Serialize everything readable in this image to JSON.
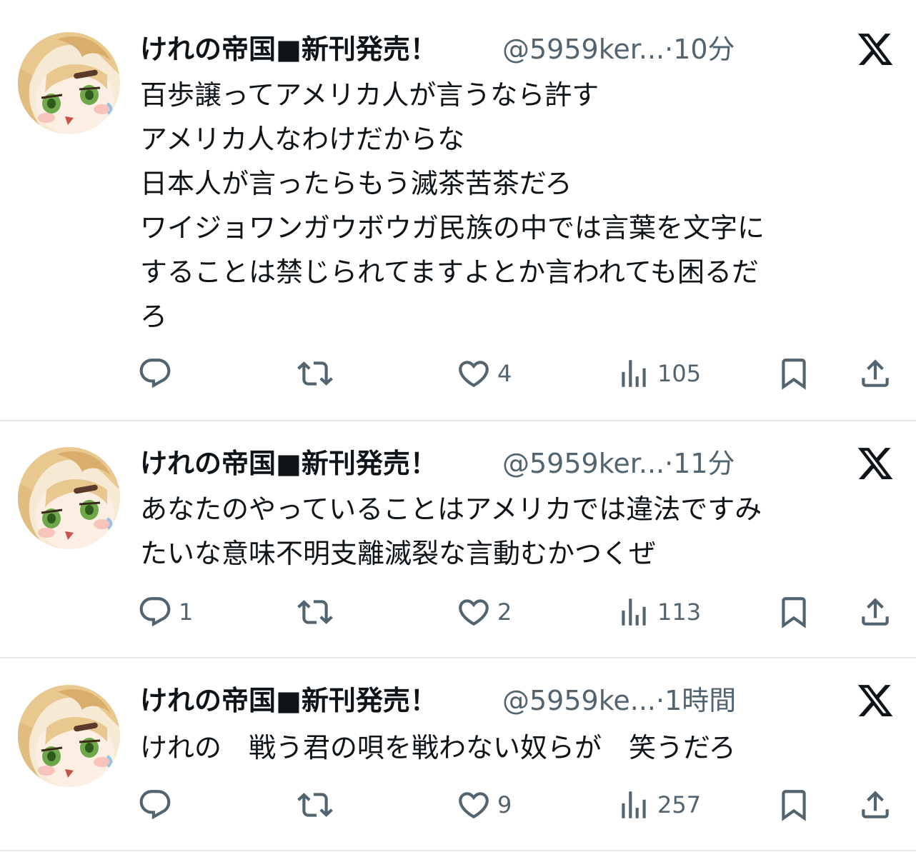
{
  "tweets": [
    {
      "name": "けれの帝国■新刊発売！",
      "handle": "@5959ker...",
      "dot": "·",
      "time": "10分",
      "lines": [
        "百歩譲ってアメリカ人が言うなら許す",
        "アメリカ人なわけだからな",
        "日本人が言ったらもう滅茶苦茶だろ",
        "ワイジョワンガウボウガ民族の中では言葉を文字に",
        "することは禁じられてますよとか言われても困るだ",
        "ろ"
      ],
      "reply_count": "",
      "like_count": "4",
      "view_count": "105"
    },
    {
      "name": "けれの帝国■新刊発売！",
      "handle": "@5959ker...",
      "dot": "·",
      "time": "11分",
      "lines": [
        "あなたのやっていることはアメリカでは違法ですみ",
        "たいな意味不明支離滅裂な言動むかつくぜ"
      ],
      "reply_count": "1",
      "like_count": "2",
      "view_count": "113"
    },
    {
      "name": "けれの帝国■新刊発売！",
      "handle": "@5959ke...",
      "dot": "·",
      "time": "1時間",
      "lines": [
        "けれの　戦う君の唄を戦わない奴らが　笑うだろ"
      ],
      "reply_count": "",
      "like_count": "9",
      "view_count": "257"
    }
  ],
  "icons": {
    "reply": "reply-icon",
    "retweet": "retweet-icon",
    "like": "heart-icon",
    "views": "views-icon",
    "bookmark": "bookmark-icon",
    "share": "share-icon",
    "more": "x-logo-icon"
  },
  "colors": {
    "text": "#0f1419",
    "secondary": "#536471",
    "divider": "#e6e9eb"
  }
}
